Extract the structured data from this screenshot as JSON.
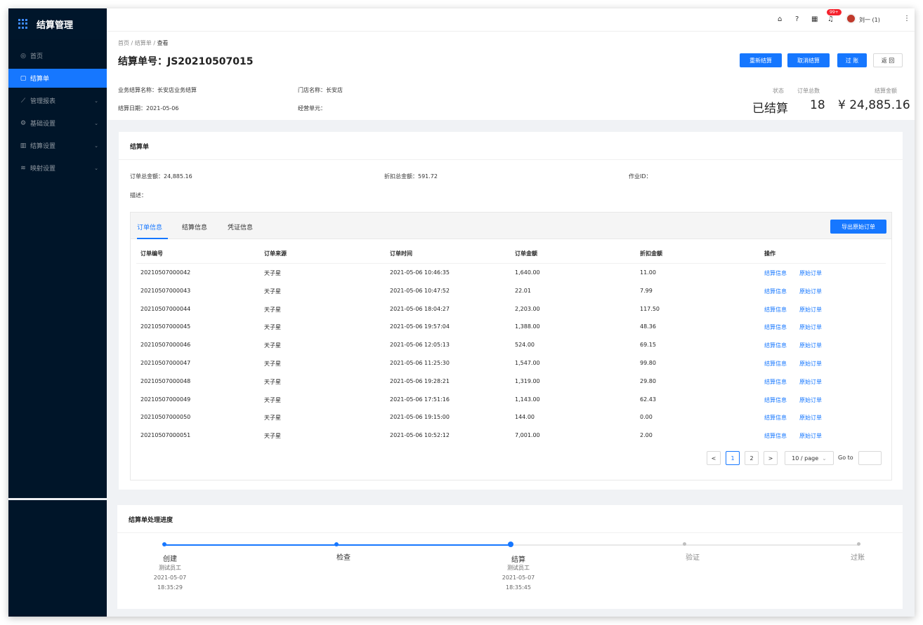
{
  "app": {
    "title": "结算管理"
  },
  "sidebar": {
    "items": [
      {
        "label": "首页",
        "icon": "◎"
      },
      {
        "label": "结算单",
        "icon": "▢"
      },
      {
        "label": "管理报表",
        "icon": "⟋"
      },
      {
        "label": "基础设置",
        "icon": "⚙"
      },
      {
        "label": "结算设置",
        "icon": "▥"
      },
      {
        "label": "映射设置",
        "icon": "≋"
      }
    ]
  },
  "topbar": {
    "badge": "99+",
    "user": "刘一 (1)"
  },
  "breadcrumb": {
    "home": "首页",
    "list": "结算单",
    "current": "查看"
  },
  "header": {
    "title": "结算单号：JS20210507015",
    "business_name": "业务结算名称：长安店业务结算",
    "store_name": "门店名称：长安店",
    "settle_date": "结算日期：2021-05-06",
    "unit": "经营单元："
  },
  "actions": {
    "resettle": "重新结算",
    "cancel": "取消结算",
    "post": "过 账",
    "back": "返 回"
  },
  "stats": {
    "status_label": "状态",
    "status_value": "已结算",
    "count_label": "订单总数",
    "count_value": "18",
    "amount_label": "结算金额",
    "amount_value": "¥ 24,885.16"
  },
  "card": {
    "title": "结算单",
    "order_total": "订单总金额：24,885.16",
    "discount_total": "折扣总金额：591.72",
    "job_id": "作业ID：",
    "desc": "描述："
  },
  "tabs": {
    "t1": "订单信息",
    "t2": "结算信息",
    "t3": "凭证信息",
    "export": "导出原始订单"
  },
  "table": {
    "headers": [
      "订单编号",
      "订单来源",
      "订单时间",
      "订单金额",
      "折扣金额",
      "操作"
    ],
    "action1": "结算信息",
    "action2": "原始订单",
    "rows": [
      [
        "20210507000042",
        "天子星",
        "2021-05-06 10:46:35",
        "1,640.00",
        "11.00"
      ],
      [
        "20210507000043",
        "天子星",
        "2021-05-06 10:47:52",
        "22.01",
        "7.99"
      ],
      [
        "20210507000044",
        "天子星",
        "2021-05-06 18:04:27",
        "2,203.00",
        "117.50"
      ],
      [
        "20210507000045",
        "天子星",
        "2021-05-06 19:57:04",
        "1,388.00",
        "48.36"
      ],
      [
        "20210507000046",
        "天子星",
        "2021-05-06 12:05:13",
        "524.00",
        "69.15"
      ],
      [
        "20210507000047",
        "天子星",
        "2021-05-06 11:25:30",
        "1,547.00",
        "99.80"
      ],
      [
        "20210507000048",
        "天子星",
        "2021-05-06 19:28:21",
        "1,319.00",
        "29.80"
      ],
      [
        "20210507000049",
        "天子星",
        "2021-05-06 17:51:16",
        "1,143.00",
        "62.43"
      ],
      [
        "20210507000050",
        "天子星",
        "2021-05-06 19:15:00",
        "144.00",
        "0.00"
      ],
      [
        "20210507000051",
        "天子星",
        "2021-05-06 10:52:12",
        "7,001.00",
        "2.00"
      ]
    ]
  },
  "pagination": {
    "prev": "<",
    "p1": "1",
    "p2": "2",
    "next": ">",
    "size": "10 / page",
    "goto": "Go to"
  },
  "progress": {
    "title": "结算单处理进度",
    "steps": [
      {
        "name": "创建",
        "person": "测试员工",
        "date": "2021-05-07",
        "time": "18:35:29"
      },
      {
        "name": "检查"
      },
      {
        "name": "结算",
        "person": "测试员工",
        "date": "2021-05-07",
        "time": "18:35:45"
      },
      {
        "name": "验证"
      },
      {
        "name": "过账"
      }
    ]
  },
  "colors": {
    "primary": "#1677ff",
    "sidebar": "#001529",
    "danger": "#f5222d"
  }
}
